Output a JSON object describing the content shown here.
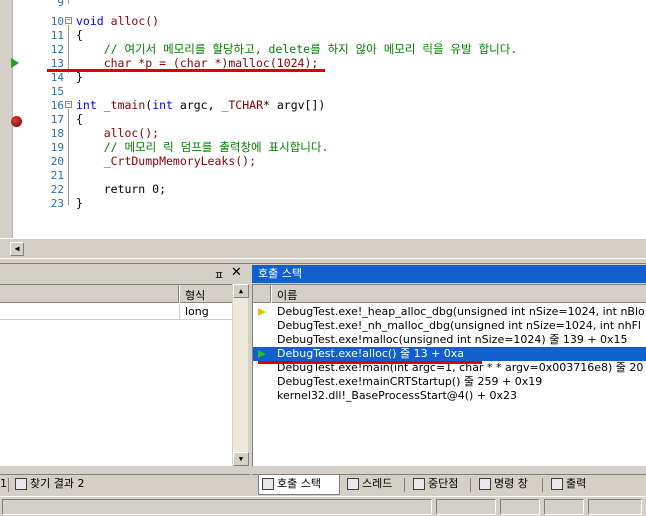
{
  "editor": {
    "lines": [
      {
        "num": "9",
        "html_parts": []
      },
      {
        "num": "10",
        "text": "void alloc()"
      },
      {
        "num": "11",
        "text": "{"
      },
      {
        "num": "12",
        "text": "    // 여기서 메모리를 할당하고, delete를 하지 않아 메모리 릭을 유발 합니다."
      },
      {
        "num": "13",
        "text": "    char *p = (char *)malloc(1024);"
      },
      {
        "num": "14",
        "text": "}"
      },
      {
        "num": "15",
        "text": ""
      },
      {
        "num": "16",
        "text": "int _tmain(int argc, _TCHAR* argv[])"
      },
      {
        "num": "17",
        "text": "{"
      },
      {
        "num": "18",
        "text": "    alloc();"
      },
      {
        "num": "19",
        "text": "    // 메모리 릭 덤프를 출력창에 표시합니다."
      },
      {
        "num": "20",
        "text": "    _CrtDumpMemoryLeaks();"
      },
      {
        "num": "21",
        "text": ""
      },
      {
        "num": "22",
        "text": "    return 0;"
      },
      {
        "num": "23",
        "text": "}"
      }
    ],
    "colors": {
      "keyword": "#0000ff",
      "comment": "#008000",
      "function": "#8b0000",
      "line_number": "#2f6f9f",
      "highlight": "#e00000"
    }
  },
  "locals_pane": {
    "column_type": "형식",
    "rows": [
      {
        "type": "long"
      }
    ]
  },
  "call_stack": {
    "title": "호출 스택",
    "column_name": "이름",
    "rows": [
      {
        "text": "DebugTest.exe!_heap_alloc_dbg(unsigned int nSize=1024, int nBlo",
        "marker": "current"
      },
      {
        "text": "DebugTest.exe!_nh_malloc_dbg(unsigned int nSize=1024, int nhFl",
        "marker": ""
      },
      {
        "text": "DebugTest.exe!malloc(unsigned int nSize=1024)  줄 139 + 0x15",
        "marker": ""
      },
      {
        "text": "DebugTest.exe!alloc()  줄 13 + 0xa",
        "marker": "selected"
      },
      {
        "text": "DebugTest.exe!main(int argc=1, char * * argv=0x003716e8)  줄 20",
        "marker": ""
      },
      {
        "text": "DebugTest.exe!mainCRTStartup()  줄 259 + 0x19",
        "marker": ""
      },
      {
        "text": "kernel32.dll!_BaseProcessStart@4()  + 0x23",
        "marker": ""
      }
    ]
  },
  "left_tabs": [
    {
      "label": "1"
    },
    {
      "label": "찾기 결과 2"
    }
  ],
  "right_tabs": [
    {
      "label": "호출 스택"
    },
    {
      "label": "스레드"
    },
    {
      "label": "중단점"
    },
    {
      "label": "명령 창"
    },
    {
      "label": "출력"
    }
  ],
  "icons": {
    "pin": "pin-icon",
    "close": "close-icon"
  }
}
